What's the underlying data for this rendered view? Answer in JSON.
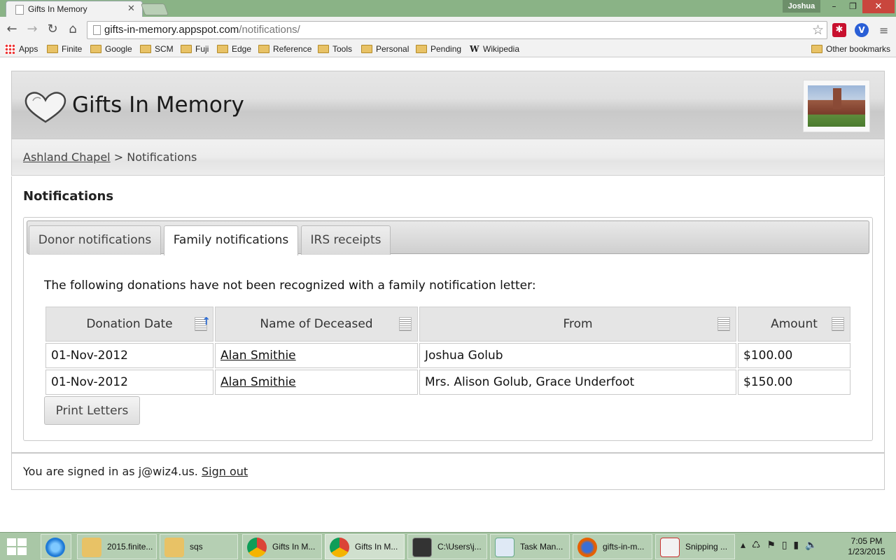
{
  "browser": {
    "tab_title": "Gifts In Memory",
    "profile_name": "Joshua",
    "url_host": "gifts-in-memory.appspot.com",
    "url_path": "/notifications/",
    "bookmarks": [
      "Apps",
      "Finite",
      "Google",
      "SCM",
      "Fuji",
      "Edge",
      "Reference",
      "Tools",
      "Personal",
      "Pending",
      "Wikipedia"
    ],
    "other_bookmarks": "Other bookmarks"
  },
  "header": {
    "site_title": "Gifts In Memory"
  },
  "breadcrumb": {
    "parent": "Ashland Chapel",
    "separator": ">",
    "current": "Notifications"
  },
  "panel": {
    "title": "Notifications",
    "tabs": [
      "Donor notifications",
      "Family notifications",
      "IRS receipts"
    ],
    "active_tab": "Family notifications",
    "intro": "The following donations have not been recognized with a family notification letter:",
    "columns": [
      "Donation Date",
      "Name of Deceased",
      "From",
      "Amount"
    ],
    "rows": [
      {
        "date": "01-Nov-2012",
        "deceased": "Alan Smithie",
        "from": "Joshua Golub",
        "amount": "$100.00"
      },
      {
        "date": "01-Nov-2012",
        "deceased": "Alan Smithie",
        "from": "Mrs. Alison Golub, Grace Underfoot",
        "amount": "$150.00"
      }
    ],
    "print_button": "Print Letters"
  },
  "footer": {
    "signed_in_prefix": "You are signed in as j@wiz4.us.",
    "sign_out": "Sign out"
  },
  "taskbar": {
    "items": [
      "2015.finite...",
      "sqs",
      "Gifts In M...",
      "Gifts In M...",
      "C:\\Users\\j...",
      "Task Man...",
      "gifts-in-m...",
      "Snipping ..."
    ],
    "time": "7:05 PM",
    "date": "1/23/2015"
  },
  "colors": {
    "window_frame": "#8ab386",
    "close_button": "#c9463d",
    "taskbar": "#a9c7a6"
  }
}
